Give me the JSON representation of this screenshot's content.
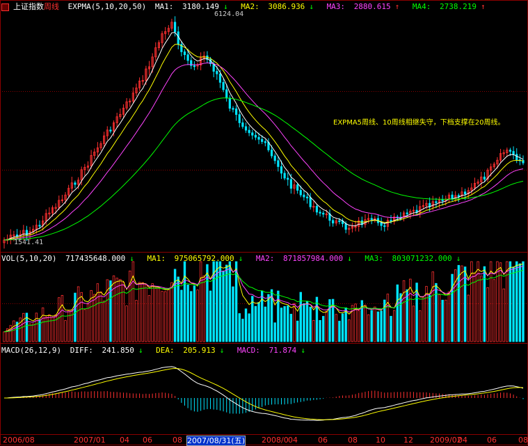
{
  "main": {
    "index_name": "上证指数",
    "period": "周线",
    "indicator": "EXPMA(5,10,20,50)",
    "ma1_label": "MA1:",
    "ma1_value": "3180.149",
    "ma2_label": "MA2:",
    "ma2_value": "3086.936",
    "ma3_label": "MA3:",
    "ma3_value": "2880.615",
    "ma4_label": "MA4:",
    "ma4_value": "2738.219",
    "high_label": "6124.04",
    "low_label": "1541.41",
    "annotation": "EXPMA5周线、10周线相继失守，下档支撑在20周线。"
  },
  "volume": {
    "indicator": "VOL(5,10,20)",
    "value": "717435648.000",
    "ma1_label": "MA1:",
    "ma1_value": "975065792.000",
    "ma2_label": "MA2:",
    "ma2_value": "871857984.000",
    "ma3_label": "MA3:",
    "ma3_value": "803071232.000"
  },
  "macd": {
    "indicator": "MACD(26,12,9)",
    "diff_label": "DIFF:",
    "diff_value": "241.850",
    "dea_label": "DEA:",
    "dea_value": "205.913",
    "macd_label": "MACD:",
    "macd_value": "71.874"
  },
  "x_axis": {
    "labels": [
      "2006/08",
      "2007/01",
      "04",
      "06",
      "08",
      "2007/08/31(五)",
      "2008/0",
      "04",
      "06",
      "08",
      "10",
      "12",
      "2009/02",
      "04",
      "06",
      "08"
    ],
    "active_index": 5
  },
  "colors": {
    "up": "#ff3030",
    "down": "#00e5ff",
    "ma1": "#ffffff",
    "ma2": "#ffff00",
    "ma3": "#ff44ff",
    "ma4": "#00ff00",
    "grid": "#8b0000"
  },
  "icons": {
    "corner": "window-menu-icon",
    "down_arrow": "↓",
    "up_arrow": "↑"
  }
}
